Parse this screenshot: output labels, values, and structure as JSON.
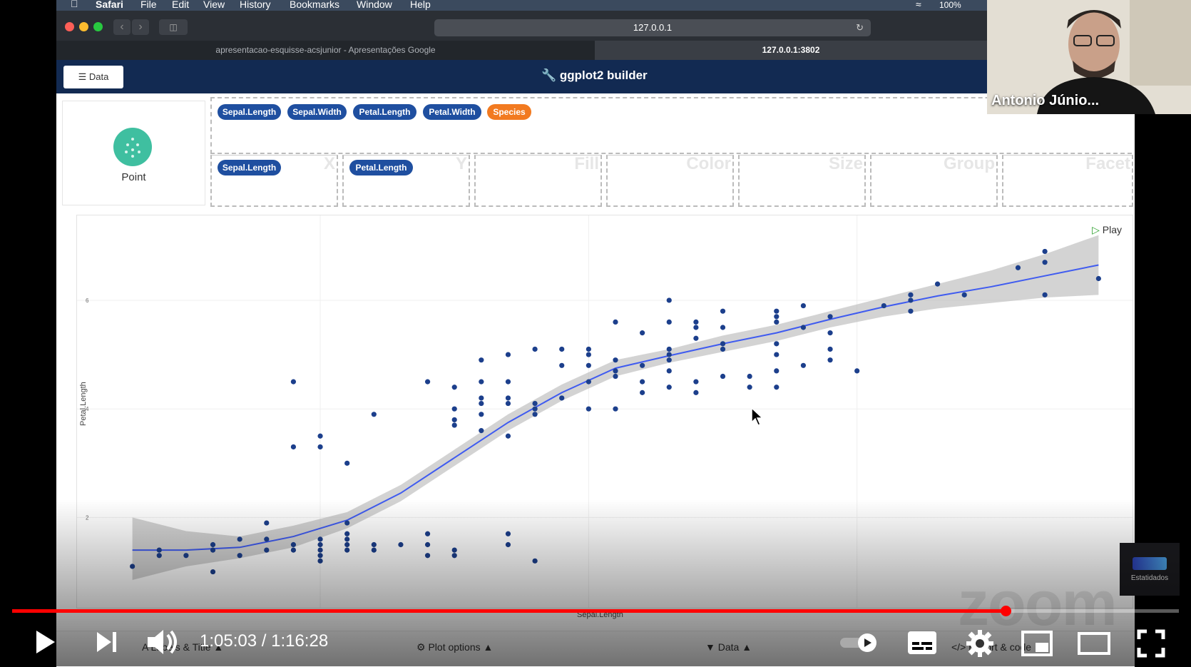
{
  "menubar": {
    "items": [
      "Safari",
      "File",
      "Edit",
      "View",
      "History",
      "Bookmarks",
      "Window",
      "Help"
    ],
    "battery": "100%"
  },
  "browser": {
    "url": "127.0.0.1",
    "tabs": [
      {
        "label": "apresentacao-esquisse-acsjunior - Apresentações Google"
      },
      {
        "label": "127.0.0.1:3802"
      }
    ]
  },
  "app": {
    "data_button": "Data",
    "title": "ggplot2 builder",
    "geom_label": "Point",
    "variables": [
      "Sepal.Length",
      "Sepal.Width",
      "Petal.Length",
      "Petal.Width",
      "Species"
    ],
    "slots": [
      {
        "label": "X",
        "value": "Sepal.Length"
      },
      {
        "label": "Y",
        "value": "Petal.Length"
      },
      {
        "label": "Fill",
        "value": ""
      },
      {
        "label": "Color",
        "value": ""
      },
      {
        "label": "Size",
        "value": ""
      },
      {
        "label": "Group",
        "value": ""
      },
      {
        "label": "Facet",
        "value": ""
      }
    ],
    "play_label": "Play",
    "bottom_tabs": [
      "Labels & Title",
      "Plot options",
      "Data",
      "Export & code"
    ]
  },
  "chart_data": {
    "type": "scatter",
    "xlabel": "Sepal.Length",
    "ylabel": "Petal.Length",
    "xlim": [
      4.2,
      8.0
    ],
    "ylim": [
      0.6,
      7.3
    ],
    "yticks": [
      2,
      4,
      6
    ],
    "points": [
      [
        4.3,
        1.1
      ],
      [
        4.4,
        1.3
      ],
      [
        4.4,
        1.4
      ],
      [
        4.5,
        1.3
      ],
      [
        4.6,
        1.0
      ],
      [
        4.6,
        1.4
      ],
      [
        4.6,
        1.5
      ],
      [
        4.7,
        1.3
      ],
      [
        4.7,
        1.6
      ],
      [
        4.8,
        1.4
      ],
      [
        4.8,
        1.6
      ],
      [
        4.8,
        1.9
      ],
      [
        4.9,
        1.4
      ],
      [
        4.9,
        1.5
      ],
      [
        4.9,
        3.3
      ],
      [
        4.9,
        4.5
      ],
      [
        5.0,
        1.2
      ],
      [
        5.0,
        1.3
      ],
      [
        5.0,
        1.4
      ],
      [
        5.0,
        1.5
      ],
      [
        5.0,
        1.6
      ],
      [
        5.0,
        3.3
      ],
      [
        5.0,
        3.5
      ],
      [
        5.1,
        1.4
      ],
      [
        5.1,
        1.5
      ],
      [
        5.1,
        1.6
      ],
      [
        5.1,
        1.7
      ],
      [
        5.1,
        1.9
      ],
      [
        5.1,
        3.0
      ],
      [
        5.2,
        1.4
      ],
      [
        5.2,
        1.5
      ],
      [
        5.2,
        3.9
      ],
      [
        5.3,
        1.5
      ],
      [
        5.4,
        1.3
      ],
      [
        5.4,
        1.5
      ],
      [
        5.4,
        1.7
      ],
      [
        5.4,
        4.5
      ],
      [
        5.5,
        1.3
      ],
      [
        5.5,
        1.4
      ],
      [
        5.5,
        3.7
      ],
      [
        5.5,
        3.8
      ],
      [
        5.5,
        4.0
      ],
      [
        5.5,
        4.4
      ],
      [
        5.6,
        3.6
      ],
      [
        5.6,
        3.9
      ],
      [
        5.6,
        4.1
      ],
      [
        5.6,
        4.2
      ],
      [
        5.6,
        4.5
      ],
      [
        5.6,
        4.9
      ],
      [
        5.7,
        1.5
      ],
      [
        5.7,
        1.7
      ],
      [
        5.7,
        3.5
      ],
      [
        5.7,
        4.1
      ],
      [
        5.7,
        4.2
      ],
      [
        5.7,
        4.5
      ],
      [
        5.7,
        5.0
      ],
      [
        5.8,
        1.2
      ],
      [
        5.8,
        3.9
      ],
      [
        5.8,
        4.0
      ],
      [
        5.8,
        4.1
      ],
      [
        5.8,
        5.1
      ],
      [
        5.9,
        4.2
      ],
      [
        5.9,
        4.8
      ],
      [
        5.9,
        5.1
      ],
      [
        6.0,
        4.0
      ],
      [
        6.0,
        4.5
      ],
      [
        6.0,
        4.8
      ],
      [
        6.0,
        5.0
      ],
      [
        6.0,
        5.1
      ],
      [
        6.1,
        4.0
      ],
      [
        6.1,
        4.6
      ],
      [
        6.1,
        4.7
      ],
      [
        6.1,
        4.9
      ],
      [
        6.1,
        5.6
      ],
      [
        6.2,
        4.3
      ],
      [
        6.2,
        4.5
      ],
      [
        6.2,
        4.8
      ],
      [
        6.2,
        5.4
      ],
      [
        6.3,
        4.4
      ],
      [
        6.3,
        4.7
      ],
      [
        6.3,
        4.9
      ],
      [
        6.3,
        5.0
      ],
      [
        6.3,
        5.1
      ],
      [
        6.3,
        5.6
      ],
      [
        6.3,
        6.0
      ],
      [
        6.4,
        4.3
      ],
      [
        6.4,
        4.5
      ],
      [
        6.4,
        5.3
      ],
      [
        6.4,
        5.5
      ],
      [
        6.4,
        5.6
      ],
      [
        6.5,
        4.6
      ],
      [
        6.5,
        5.1
      ],
      [
        6.5,
        5.2
      ],
      [
        6.5,
        5.5
      ],
      [
        6.5,
        5.8
      ],
      [
        6.6,
        4.4
      ],
      [
        6.6,
        4.6
      ],
      [
        6.7,
        4.4
      ],
      [
        6.7,
        4.7
      ],
      [
        6.7,
        5.0
      ],
      [
        6.7,
        5.2
      ],
      [
        6.7,
        5.6
      ],
      [
        6.7,
        5.7
      ],
      [
        6.7,
        5.8
      ],
      [
        6.8,
        4.8
      ],
      [
        6.8,
        5.5
      ],
      [
        6.8,
        5.9
      ],
      [
        6.9,
        4.9
      ],
      [
        6.9,
        5.1
      ],
      [
        6.9,
        5.4
      ],
      [
        6.9,
        5.7
      ],
      [
        7.0,
        4.7
      ],
      [
        7.1,
        5.9
      ],
      [
        7.2,
        5.8
      ],
      [
        7.2,
        6.0
      ],
      [
        7.2,
        6.1
      ],
      [
        7.3,
        6.3
      ],
      [
        7.4,
        6.1
      ],
      [
        7.6,
        6.6
      ],
      [
        7.7,
        6.1
      ],
      [
        7.7,
        6.7
      ],
      [
        7.7,
        6.9
      ],
      [
        7.9,
        6.4
      ]
    ],
    "smooth": {
      "x": [
        4.3,
        4.5,
        4.7,
        4.9,
        5.1,
        5.3,
        5.5,
        5.7,
        5.9,
        6.1,
        6.3,
        6.5,
        6.7,
        6.9,
        7.1,
        7.3,
        7.5,
        7.7,
        7.9
      ],
      "y": [
        1.4,
        1.4,
        1.45,
        1.65,
        1.95,
        2.45,
        3.1,
        3.75,
        4.3,
        4.75,
        4.98,
        5.2,
        5.4,
        5.65,
        5.88,
        6.08,
        6.25,
        6.45,
        6.65
      ],
      "lower": [
        0.85,
        1.1,
        1.25,
        1.45,
        1.8,
        2.3,
        2.95,
        3.6,
        4.15,
        4.6,
        4.85,
        5.05,
        5.25,
        5.5,
        5.7,
        5.85,
        5.95,
        6.05,
        6.1
      ],
      "upper": [
        2.0,
        1.75,
        1.65,
        1.85,
        2.1,
        2.6,
        3.25,
        3.9,
        4.45,
        4.9,
        5.1,
        5.35,
        5.55,
        5.8,
        6.05,
        6.3,
        6.55,
        6.85,
        7.2
      ]
    }
  },
  "video": {
    "current_time": "1:05:03",
    "separator": " / ",
    "duration": "1:16:28",
    "progress": 0.852
  },
  "webcam": {
    "name": "Antonio Júnio..."
  },
  "watermark": "zoom",
  "logo_text": "Estatidados"
}
